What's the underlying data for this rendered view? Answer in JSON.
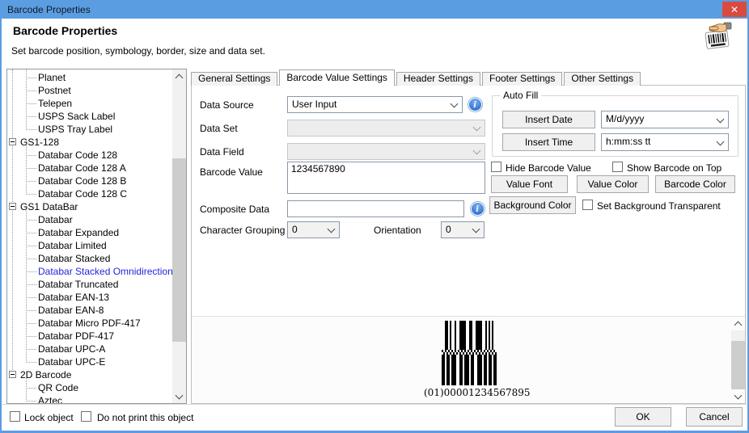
{
  "window": {
    "title": "Barcode Properties",
    "close_glyph": "✕"
  },
  "header": {
    "title": "Barcode Properties",
    "subtitle": "Set barcode position, symbology, border, size and data set."
  },
  "tree": {
    "items": [
      {
        "label": "Planet",
        "level": 2
      },
      {
        "label": "Postnet",
        "level": 2
      },
      {
        "label": "Telepen",
        "level": 2
      },
      {
        "label": "USPS Sack Label",
        "level": 2
      },
      {
        "label": "USPS Tray Label",
        "level": 2
      },
      {
        "label": "GS1-128",
        "level": 1,
        "expanded": true
      },
      {
        "label": "Databar Code 128",
        "level": 2
      },
      {
        "label": "Databar Code 128 A",
        "level": 2
      },
      {
        "label": "Databar Code 128 B",
        "level": 2
      },
      {
        "label": "Databar Code 128 C",
        "level": 2
      },
      {
        "label": "GS1 DataBar",
        "level": 1,
        "expanded": true
      },
      {
        "label": "Databar",
        "level": 2
      },
      {
        "label": "Databar Expanded",
        "level": 2
      },
      {
        "label": "Databar Limited",
        "level": 2
      },
      {
        "label": "Databar Stacked",
        "level": 2
      },
      {
        "label": "Databar Stacked Omnidirectional",
        "level": 2,
        "selected": true
      },
      {
        "label": "Databar Truncated",
        "level": 2
      },
      {
        "label": "Databar EAN-13",
        "level": 2
      },
      {
        "label": "Databar EAN-8",
        "level": 2
      },
      {
        "label": "Databar Micro PDF-417",
        "level": 2
      },
      {
        "label": "Databar PDF-417",
        "level": 2
      },
      {
        "label": "Databar UPC-A",
        "level": 2
      },
      {
        "label": "Databar UPC-E",
        "level": 2
      },
      {
        "label": "2D Barcode",
        "level": 1,
        "expanded": true
      },
      {
        "label": "QR Code",
        "level": 2
      },
      {
        "label": "Aztec",
        "level": 2
      }
    ]
  },
  "tabs": [
    {
      "label": "General Settings",
      "active": false
    },
    {
      "label": "Barcode Value Settings",
      "active": true
    },
    {
      "label": "Header Settings",
      "active": false
    },
    {
      "label": "Footer Settings",
      "active": false
    },
    {
      "label": "Other Settings",
      "active": false
    }
  ],
  "form": {
    "data_source_label": "Data Source",
    "data_source_value": "User Input",
    "data_set_label": "Data Set",
    "data_set_value": "",
    "data_field_label": "Data Field",
    "data_field_value": "",
    "barcode_value_label": "Barcode Value",
    "barcode_value": "1234567890",
    "composite_data_label": "Composite Data",
    "composite_data_value": "",
    "character_grouping_label": "Character Grouping",
    "character_grouping_value": "0",
    "orientation_label": "Orientation",
    "orientation_value": "0"
  },
  "auto_fill": {
    "group_label": "Auto Fill",
    "insert_date_button": "Insert Date",
    "date_format_value": "M/d/yyyy",
    "insert_time_button": "Insert Time",
    "time_format_value": "h:mm:ss tt"
  },
  "options": {
    "hide_barcode_value": "Hide Barcode Value",
    "show_barcode_on_top": "Show Barcode on Top",
    "value_font": "Value Font",
    "value_color": "Value Color",
    "barcode_color": "Barcode Color",
    "background_color": "Background Color",
    "set_background_transparent": "Set Background Transparent"
  },
  "preview": {
    "encoded_text": "(01)00001234567895",
    "top_modules": "110100100111100110011110010101",
    "bottom_modules": "1101101110011011101100111011011011"
  },
  "footer": {
    "lock_object": "Lock object",
    "do_not_print": "Do not print this object",
    "ok": "OK",
    "cancel": "Cancel"
  },
  "colors": {
    "accent_blue": "#5b9de1",
    "close_red": "#d94b40",
    "selected_text": "#2424e0"
  }
}
